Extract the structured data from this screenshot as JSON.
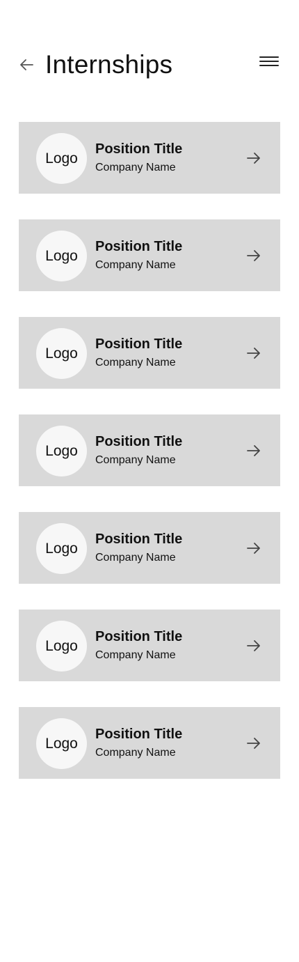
{
  "header": {
    "title": "Internships",
    "back_icon": "arrow-left-icon",
    "menu_icon": "hamburger-menu-icon"
  },
  "internships": [
    {
      "logo": "Logo",
      "title": "Position Title",
      "company": "Company Name"
    },
    {
      "logo": "Logo",
      "title": "Position Title",
      "company": "Company Name"
    },
    {
      "logo": "Logo",
      "title": "Position Title",
      "company": "Company Name"
    },
    {
      "logo": "Logo",
      "title": "Position Title",
      "company": "Company Name"
    },
    {
      "logo": "Logo",
      "title": "Position Title",
      "company": "Company Name"
    },
    {
      "logo": "Logo",
      "title": "Position Title",
      "company": "Company Name"
    },
    {
      "logo": "Logo",
      "title": "Position Title",
      "company": "Company Name"
    }
  ],
  "colors": {
    "card_background": "#d9d9d9",
    "logo_background": "#f7f7f7",
    "text": "#111111"
  }
}
